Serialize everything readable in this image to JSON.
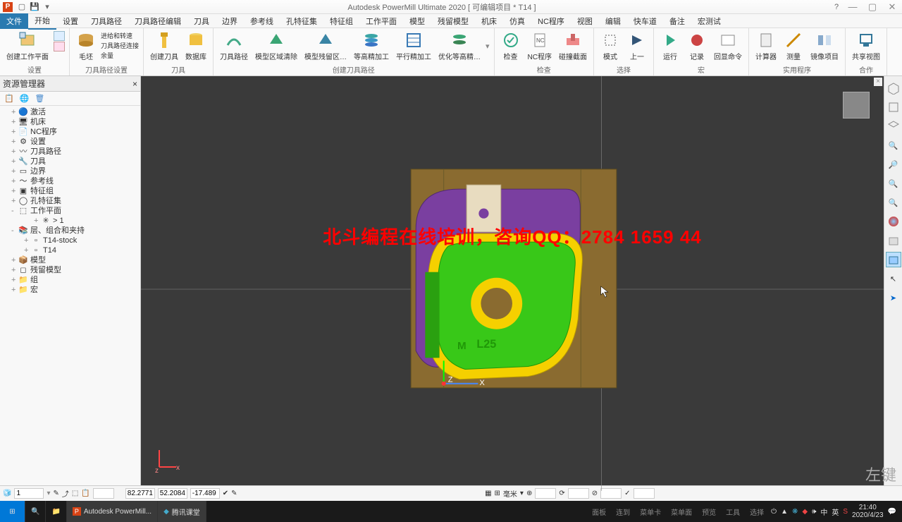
{
  "title": "Autodesk PowerMill Ultimate 2020    [ 可编辑项目 * T14 ]",
  "menu": {
    "file": "文件",
    "tabs": [
      "开始",
      "设置",
      "刀具路径",
      "刀具路径编辑",
      "刀具",
      "边界",
      "参考线",
      "孔特征集",
      "特征组",
      "工作平面",
      "模型",
      "残留模型",
      "机床",
      "仿真",
      "NC程序",
      "视图",
      "编辑",
      "快车道",
      "备注",
      "宏测试"
    ]
  },
  "ribbon": {
    "g1": {
      "label": "设置",
      "btns": [
        {
          "l": "创建工作平面"
        }
      ]
    },
    "g2": {
      "label": "刀具路径设置",
      "btns": [
        {
          "l": "毛坯"
        }
      ],
      "small": [
        "进给和转速",
        "刀具路径连接",
        "余量"
      ]
    },
    "g3": {
      "label": "刀具",
      "btns": [
        {
          "l": "创建刀具"
        },
        {
          "l": "数据库"
        }
      ]
    },
    "g4": {
      "label": "创建刀具路径",
      "btns": [
        {
          "l": "刀具路径"
        },
        {
          "l": "模型区域清除"
        },
        {
          "l": "模型残留区…"
        },
        {
          "l": "等高精加工"
        },
        {
          "l": "平行精加工"
        },
        {
          "l": "优化等高精…"
        }
      ]
    },
    "g5": {
      "label": "检查",
      "btns": [
        {
          "l": "检查"
        },
        {
          "l": "NC程序"
        },
        {
          "l": "碰撞截面"
        }
      ]
    },
    "g6": {
      "label": "选择",
      "btns": [
        {
          "l": "模式"
        },
        {
          "l": "上一"
        }
      ]
    },
    "g7": {
      "label": "宏",
      "btns": [
        {
          "l": "运行"
        },
        {
          "l": "记录"
        },
        {
          "l": "回显命令"
        }
      ]
    },
    "g8": {
      "label": "实用程序",
      "btns": [
        {
          "l": "计算器"
        },
        {
          "l": "测量"
        },
        {
          "l": "镜像项目"
        }
      ]
    },
    "g9": {
      "label": "合作",
      "btns": [
        {
          "l": "共享视图"
        }
      ]
    }
  },
  "explorer": {
    "title": "资源管理器",
    "items": [
      {
        "l": "激活",
        "d": 1
      },
      {
        "l": "机床",
        "d": 1
      },
      {
        "l": "NC程序",
        "d": 1
      },
      {
        "l": "设置",
        "d": 1
      },
      {
        "l": "刀具路径",
        "d": 1
      },
      {
        "l": "刀具",
        "d": 1
      },
      {
        "l": "边界",
        "d": 1
      },
      {
        "l": "参考线",
        "d": 1
      },
      {
        "l": "特征组",
        "d": 1
      },
      {
        "l": "孔特征集",
        "d": 1
      },
      {
        "l": "工作平面",
        "d": 1,
        "exp": "-"
      },
      {
        "l": "> 1",
        "d": 3
      },
      {
        "l": "层、组合和夹持",
        "d": 1,
        "exp": "-"
      },
      {
        "l": "T14-stock",
        "d": 2
      },
      {
        "l": "T14",
        "d": 2
      },
      {
        "l": "模型",
        "d": 1
      },
      {
        "l": "残留模型",
        "d": 1
      },
      {
        "l": "组",
        "d": 1
      },
      {
        "l": "宏",
        "d": 1
      }
    ]
  },
  "overlay": "北斗编程在线培训，咨询QQ：2784 1659 44",
  "axis": {
    "z": "Z",
    "x": "X"
  },
  "status": {
    "n": "1",
    "x": "82.2771",
    "y": "52.2084",
    "z": "-17.489",
    "unit": "毫米"
  },
  "taskbar": {
    "app": "Autodesk PowerMill...",
    "app2": "腾讯课堂",
    "time": "21:40",
    "date": "2020/4/23",
    "hints": [
      "面板",
      "连到",
      "菜单卡",
      "菜单面",
      "预览",
      "工具",
      "选择"
    ]
  },
  "mouse": "左键",
  "model": {
    "label1": "M",
    "label2": "L25"
  }
}
